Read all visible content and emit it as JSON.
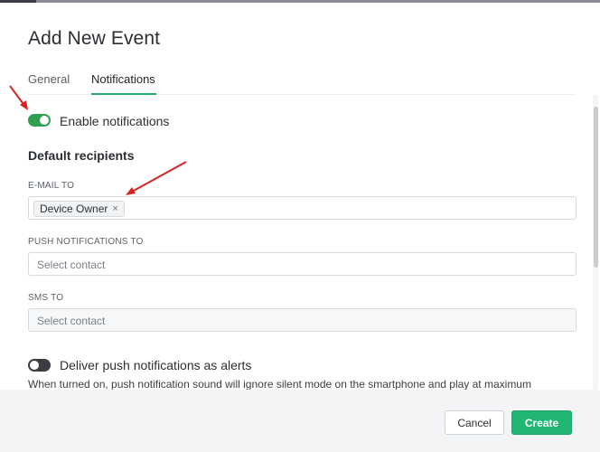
{
  "dialog": {
    "title": "Add New Event"
  },
  "tabs": [
    {
      "label": "General",
      "active": false
    },
    {
      "label": "Notifications",
      "active": true
    }
  ],
  "enable_notifications": {
    "label": "Enable notifications",
    "on": true
  },
  "default_recipients": {
    "heading": "Default recipients",
    "email": {
      "label": "E-MAIL TO",
      "chips": [
        {
          "label": "Device Owner",
          "remove_glyph": "×"
        }
      ]
    },
    "push": {
      "label": "PUSH NOTIFICATIONS TO",
      "placeholder": "Select contact"
    },
    "sms": {
      "label": "SMS TO",
      "placeholder": "Select contact"
    }
  },
  "push_alerts": {
    "label": "Deliver push notifications as alerts",
    "on": false,
    "helper": "When turned on, push notification sound will ignore silent mode on the smartphone and play at maximum"
  },
  "footer": {
    "cancel_label": "Cancel",
    "create_label": "Create"
  },
  "colors": {
    "accent": "#23b574",
    "toggle_on": "#2ea04f",
    "toggle_off": "#3a3d41",
    "annotation_arrow": "#d62424"
  },
  "icons": {
    "chip_remove": "close-icon",
    "annotation": "red-arrow-icon"
  }
}
